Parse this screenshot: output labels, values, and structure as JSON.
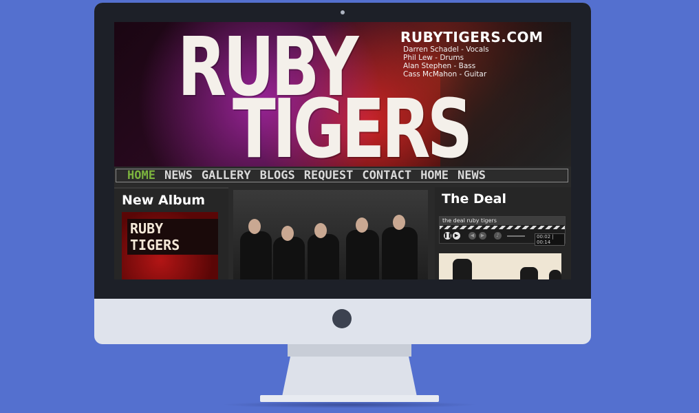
{
  "site": {
    "logo_line1": "RUBY",
    "logo_line2": "TIGERS",
    "domain": "RUBYTIGERS.COM",
    "members": [
      "Darren Schadel - Vocals",
      "Phil Lew - Drums",
      "Alan Stephen - Bass",
      "Cass McMahon - Guitar"
    ]
  },
  "nav": {
    "items": [
      "HOME",
      "NEWS",
      "GALLERY",
      "BLOGS",
      "REQUEST",
      "CONTACT",
      "HOME",
      "NEWS"
    ],
    "active_index": 0
  },
  "left": {
    "title": "New Album",
    "album_art_text": "RUBY TIGERS"
  },
  "right": {
    "title": "The Deal",
    "player": {
      "track": "the deal ruby tigers",
      "time": "00:02 | 00:14"
    }
  },
  "colors": {
    "background": "#5470cf",
    "nav_active": "#7db43e",
    "bezel": "#1d2028"
  },
  "icons": {
    "play": "play-icon",
    "pause": "pause-icon",
    "prev": "previous-icon",
    "next": "next-icon"
  }
}
